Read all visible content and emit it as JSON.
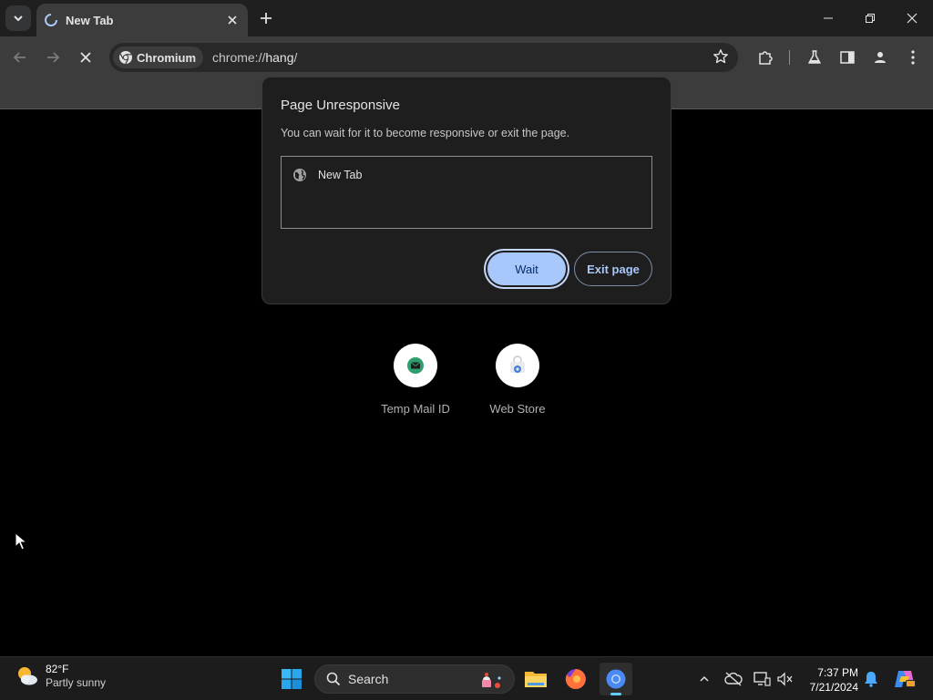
{
  "tab": {
    "title": "New Tab"
  },
  "omnibox": {
    "chip_label": "Chromium",
    "url_scheme": "chrome://",
    "url_host": "hang",
    "url_path": "/"
  },
  "dialog": {
    "title": "Page Unresponsive",
    "description": "You can wait for it to become responsive or exit the page.",
    "pages": [
      {
        "label": "New Tab"
      }
    ],
    "wait_label": "Wait",
    "exit_label": "Exit page"
  },
  "shortcuts": [
    {
      "label": "Temp Mail ID",
      "icon": "temp-mail-icon"
    },
    {
      "label": "Web Store",
      "icon": "web-store-icon"
    }
  ],
  "taskbar": {
    "weather_temp": "82°F",
    "weather_condition": "Partly sunny",
    "search_label": "Search",
    "time": "7:37 PM",
    "date": "7/21/2024"
  },
  "colors": {
    "accent": "#a8c7fa",
    "wait_text": "#062e6f",
    "toolbar": "#3c3c3c",
    "frame": "#1f1f1f"
  }
}
